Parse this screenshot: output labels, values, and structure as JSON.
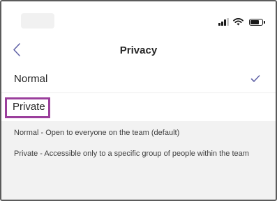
{
  "status_bar": {
    "signal_bars_active": 3,
    "signal_bars_total": 4,
    "battery_level": 0.8,
    "icons": [
      "signal-icon",
      "wifi-icon",
      "battery-icon"
    ]
  },
  "nav": {
    "back_icon": "chevron-left-icon",
    "title": "Privacy"
  },
  "options": [
    {
      "label": "Normal",
      "selected": true
    },
    {
      "label": "Private",
      "selected": false
    }
  ],
  "descriptions": {
    "normal": "Normal - Open to everyone on the team (default)",
    "private": "Private - Accessible only to a specific group of people within the team"
  },
  "colors": {
    "accent": "#6264a7",
    "highlight_border": "#9b3f9c",
    "background": "#f2f2f2"
  }
}
